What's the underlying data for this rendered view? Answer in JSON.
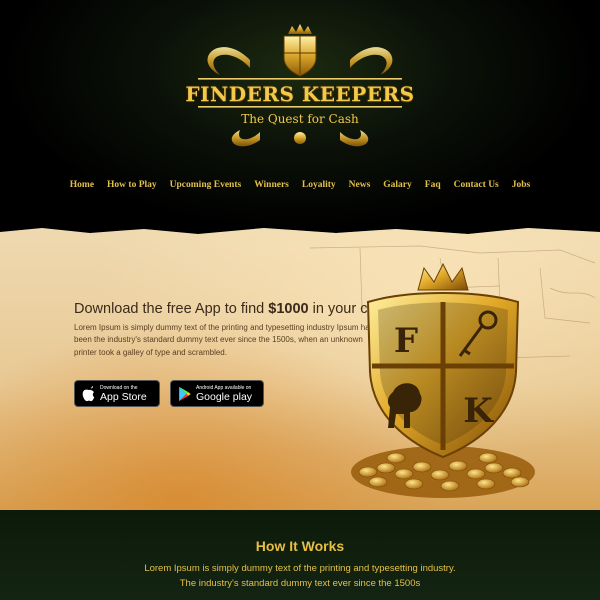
{
  "brand": {
    "title": "FINDERS KEEPERS",
    "subtitle": "The Quest for Cash",
    "crest_letters": [
      "F",
      "K"
    ]
  },
  "nav": [
    {
      "label": "Home"
    },
    {
      "label": "How to Play"
    },
    {
      "label": "Upcoming Events"
    },
    {
      "label": "Winners"
    },
    {
      "label": "Loyality"
    },
    {
      "label": "News"
    },
    {
      "label": "Galary"
    },
    {
      "label": "Faq"
    },
    {
      "label": "Contact Us"
    },
    {
      "label": "Jobs"
    }
  ],
  "hero": {
    "title_prefix": "Download the free App to find ",
    "title_amount": "$1000",
    "title_suffix": " in your city",
    "body": "Lorem Ipsum is simply dummy text of the printing and typesetting industry Ipsum has been the industry's standard dummy text ever since the 1500s, when an unknown printer took a galley of type and scrambled.",
    "app_store": {
      "small": "Download on the",
      "big": "App Store"
    },
    "google_play": {
      "small": "Android App available on",
      "big": "Google play"
    }
  },
  "how": {
    "title": "How It Works",
    "line1": "Lorem Ipsum is simply dummy text of the printing and typesetting industry.",
    "line2": "The industry's standard dummy text ever since the 1500s"
  },
  "colors": {
    "gold": "#e3c04c",
    "dark_bg": "#000000",
    "parchment": "#efd9b0",
    "footer_bg": "#0c1a0a"
  }
}
